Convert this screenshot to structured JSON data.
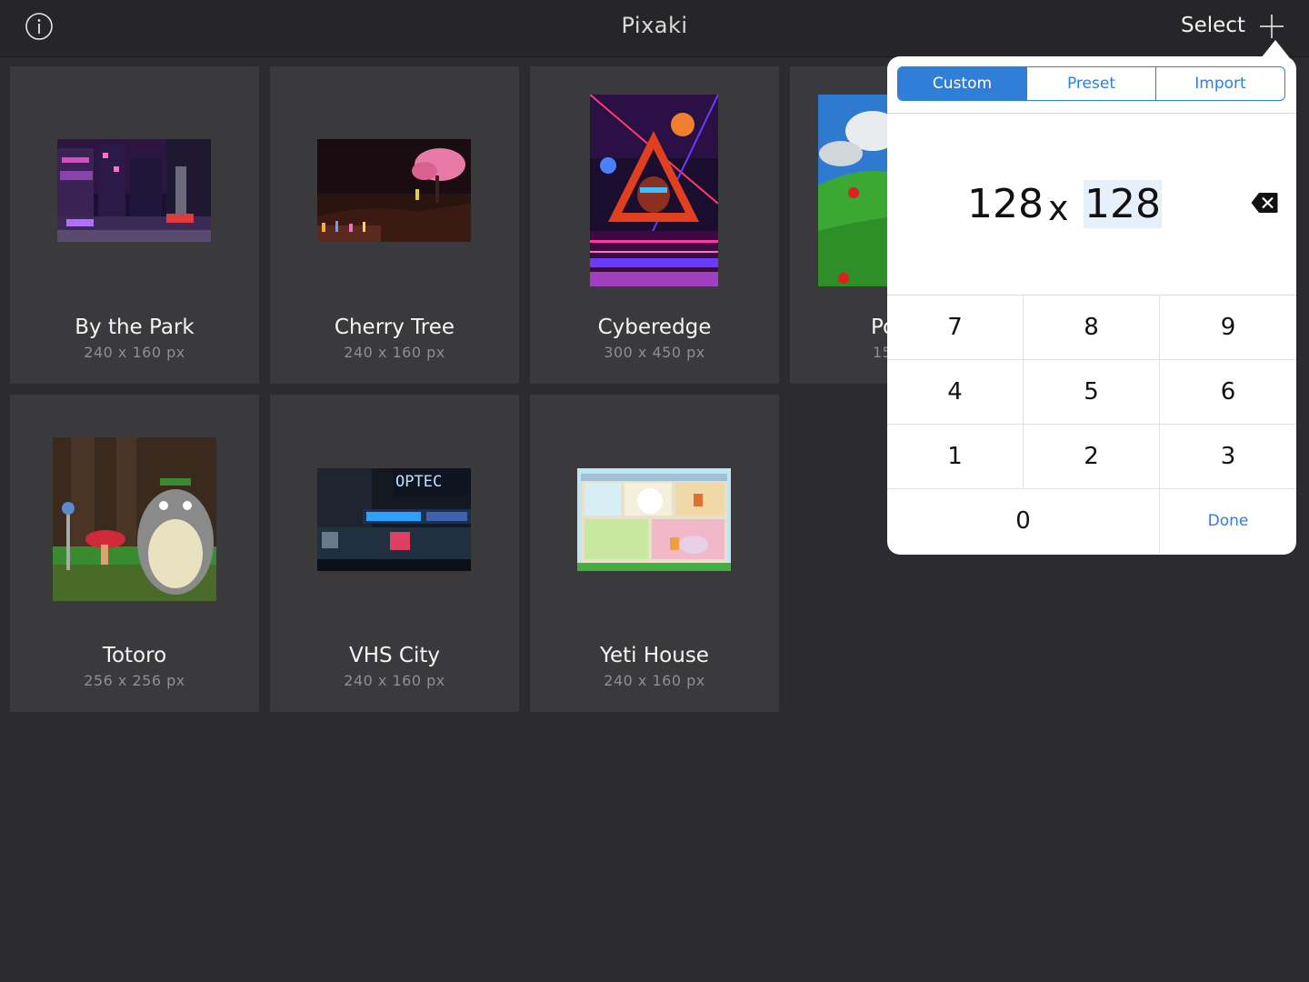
{
  "navbar": {
    "title": "Pixaki",
    "select_label": "Select",
    "info_icon": "info-icon",
    "add_icon": "plus-icon"
  },
  "gallery": [
    {
      "title": "By the Park",
      "size": "240 x 160 px"
    },
    {
      "title": "Cherry Tree",
      "size": "240 x 160 px"
    },
    {
      "title": "Cyberedge",
      "size": "300 x 450 px"
    },
    {
      "title": "Po",
      "size": "15"
    },
    {
      "title": "Totoro",
      "size": "256 x 256 px"
    },
    {
      "title": "VHS City",
      "size": "240 x 160 px"
    },
    {
      "title": "Yeti House",
      "size": "240 x 160 px"
    }
  ],
  "popover": {
    "tabs": [
      {
        "label": "Custom",
        "active": true
      },
      {
        "label": "Preset",
        "active": false
      },
      {
        "label": "Import",
        "active": false
      }
    ],
    "width_value": "128",
    "times_symbol": "x",
    "height_value": "128",
    "backspace_icon": "backspace-icon",
    "keys": [
      "7",
      "8",
      "9",
      "4",
      "5",
      "6",
      "1",
      "2",
      "3",
      "0"
    ],
    "done_label": "Done"
  },
  "colors": {
    "accent": "#2f7ed8",
    "background": "#2c2c2e",
    "card": "#3a3a3c"
  }
}
